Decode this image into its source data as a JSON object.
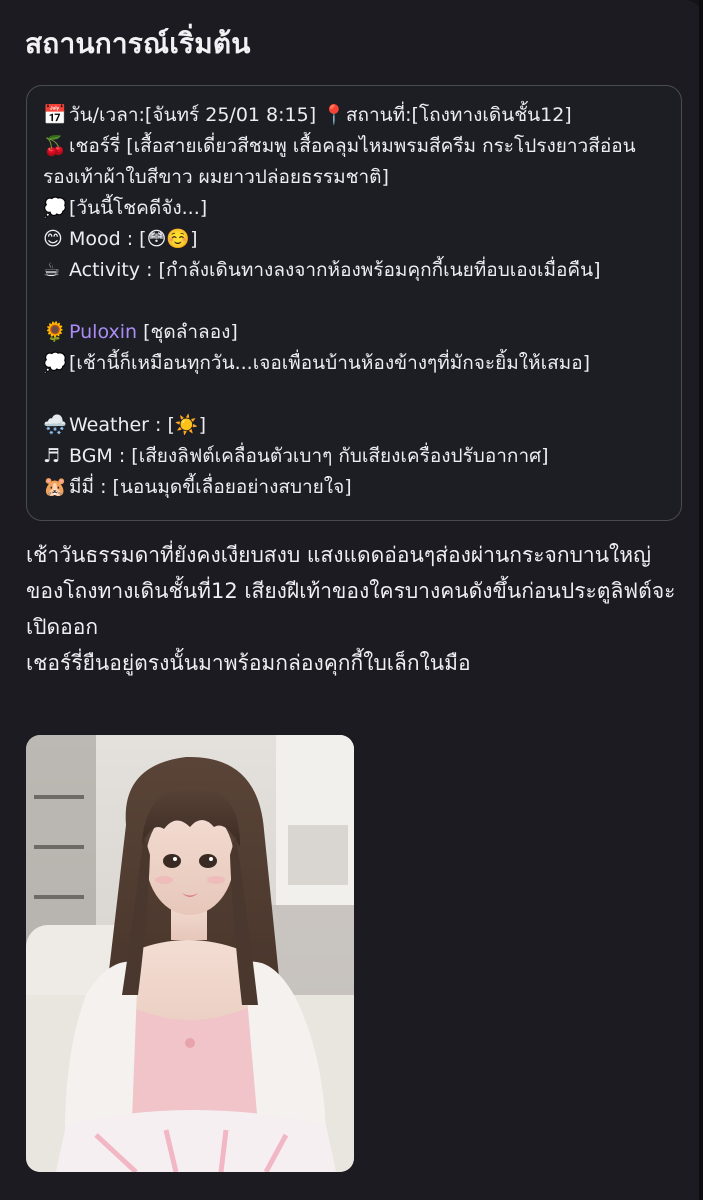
{
  "title": "สถานการณ์เริ่มต้น",
  "status": {
    "datetime": {
      "icon": "calendar-icon",
      "emoji": "📅",
      "text": "วัน/เวลา:[จันทร์ 25/01 8:15]"
    },
    "location": {
      "icon": "pin-icon",
      "emoji": "📍",
      "text": "สถานที่:[โถงทางเดินชั้น12]"
    },
    "cherry_outfit": {
      "icon": "cherry-icon",
      "emoji": "🍒",
      "text": "เชอร์รี่ [เสื้อสายเดี่ยวสีชมพู เสื้อคลุมไหมพรมสีครีม กระโปรงยาวสีอ่อน รองเท้าผ้าใบสีขาว ผมยาวปล่อยธรรมชาติ]"
    },
    "cherry_thought": {
      "icon": "thought-bubble-icon",
      "emoji": "💭",
      "text": "[วันนี้โชคดีจัง...]"
    },
    "mood": {
      "icon": "smile-icon",
      "emoji": "😊",
      "label": "Mood : [",
      "faces": "😳☺️",
      "close": "]"
    },
    "activity": {
      "icon": "coffee-icon",
      "emoji": "☕",
      "text": "Activity : [กำลังเดินทางลงจากห้องพร้อมคุกกี้เนยที่อบเองเมื่อคืน]"
    },
    "puloxin": {
      "icon": "sunflower-icon",
      "emoji": "🌻",
      "name": "Puloxin",
      "text": " [ชุดลำลอง]"
    },
    "puloxin_thought": {
      "icon": "thought-bubble-icon",
      "emoji": "💭",
      "text": "[เช้านี้ก็เหมือนทุกวัน...เจอเพื่อนบ้านห้องข้างๆที่มักจะยิ้มให้เสมอ]"
    },
    "weather": {
      "icon": "weather-icon",
      "emoji": "🌨️",
      "label": "Weather : [",
      "sun": "☀️",
      "close": "]"
    },
    "bgm": {
      "icon": "music-note-icon",
      "emoji": "♬",
      "text": "BGM : [เสียงลิฟต์เคลื่อนตัวเบาๆ กับเสียงเครื่องปรับอากาศ]"
    },
    "mimi": {
      "icon": "hamster-icon",
      "emoji": "🐹",
      "text": "มีมี่ : [นอนมุดขี้เลื่อยอย่างสบายใจ]"
    }
  },
  "narration": [
    "เช้าวันธรรมดาที่ยังคงเงียบสงบ แสงแดดอ่อนๆส่องผ่านกระจกบานใหญ่ของโถงทางเดินชั้นที่12 เสียงฝีเท้าของใครบางคนดังขึ้นก่อนประตูลิฟต์จะเปิดออก",
    "เชอร์รี่ยืนอยู่ตรงนั้นมาพร้อมกล่องคุกกี้ใบเล็กในมือ"
  ],
  "colors": {
    "background": "#131318",
    "card": "#1b1b21",
    "box_border": "#4a4a55",
    "accent_name": "#a98df5",
    "text": "#ececf1"
  }
}
